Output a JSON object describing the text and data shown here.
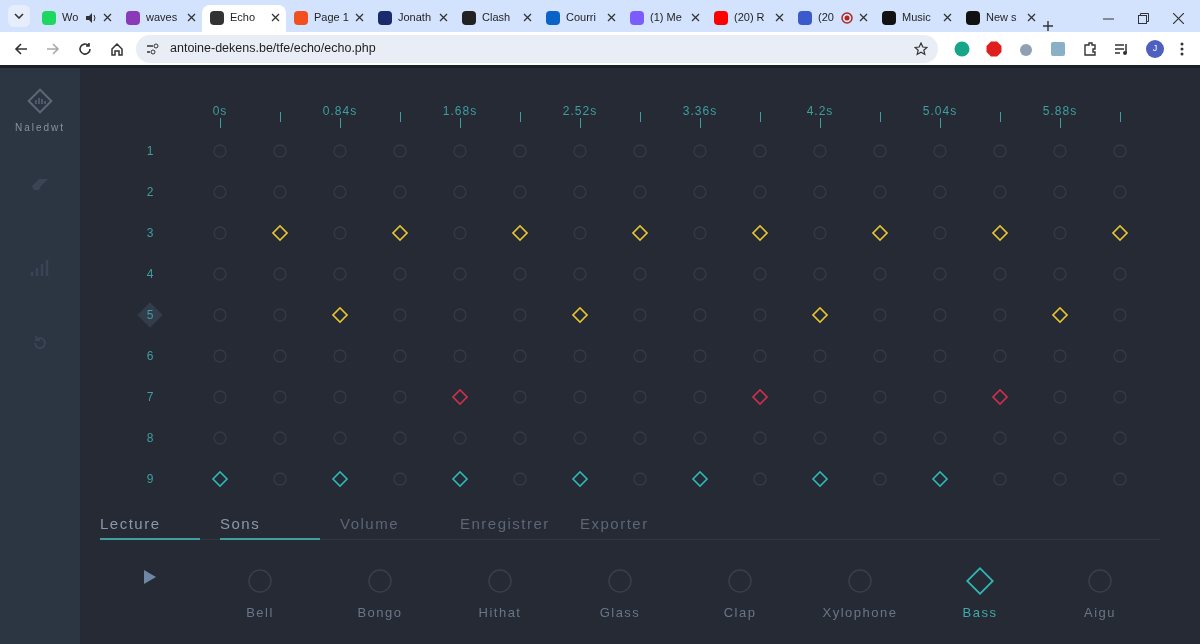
{
  "browser": {
    "tabs": [
      {
        "title": "Wo",
        "color": "#1ed760",
        "audio": true,
        "recording": false,
        "selected": false
      },
      {
        "title": "waves",
        "color": "#8a3ab9",
        "audio": false,
        "recording": false,
        "selected": false
      },
      {
        "title": "Echo",
        "color": "#333333",
        "audio": false,
        "recording": false,
        "selected": true
      },
      {
        "title": "Page 1",
        "color": "#f24e1e",
        "audio": false,
        "recording": false,
        "selected": false
      },
      {
        "title": "Jonath",
        "color": "#1a2a6c",
        "audio": false,
        "recording": false,
        "selected": false
      },
      {
        "title": "Clash",
        "color": "#222222",
        "audio": false,
        "recording": false,
        "selected": false
      },
      {
        "title": "Courri",
        "color": "#0a64c8",
        "audio": false,
        "recording": false,
        "selected": false
      },
      {
        "title": "(1) Me",
        "color": "#7b5cff",
        "audio": false,
        "recording": false,
        "selected": false
      },
      {
        "title": "(20) R",
        "color": "#ff0000",
        "audio": false,
        "recording": false,
        "selected": false
      },
      {
        "title": "(20",
        "color": "#3b5bcc",
        "audio": false,
        "recording": true,
        "selected": false
      },
      {
        "title": "Music",
        "color": "#111111",
        "audio": false,
        "recording": false,
        "selected": false
      },
      {
        "title": "New s",
        "color": "#111111",
        "audio": false,
        "recording": false,
        "selected": false
      }
    ],
    "address": "antoine-dekens.be/tfe/echo/echo.php",
    "profile": "J"
  },
  "sidebar": {
    "brand": "Naledwt"
  },
  "timeline": {
    "labels": [
      "0s",
      "0.84s",
      "1.68s",
      "2.52s",
      "3.36s",
      "4.2s",
      "5.04s",
      "5.88s"
    ]
  },
  "tracks": [
    {
      "label": "1",
      "selected": false,
      "steps": [
        false,
        false,
        false,
        false,
        false,
        false,
        false,
        false,
        false,
        false,
        false,
        false,
        false,
        false,
        false,
        false
      ]
    },
    {
      "label": "2",
      "selected": false,
      "steps": [
        false,
        false,
        false,
        false,
        false,
        false,
        false,
        false,
        false,
        false,
        false,
        false,
        false,
        false,
        false,
        false
      ]
    },
    {
      "label": "3",
      "selected": false,
      "color": "#e8c631",
      "steps": [
        false,
        true,
        false,
        true,
        false,
        true,
        false,
        true,
        false,
        true,
        false,
        true,
        false,
        true,
        false,
        true
      ]
    },
    {
      "label": "4",
      "selected": false,
      "steps": [
        false,
        false,
        false,
        false,
        false,
        false,
        false,
        false,
        false,
        false,
        false,
        false,
        false,
        false,
        false,
        false
      ]
    },
    {
      "label": "5",
      "selected": true,
      "color": "#e8c631",
      "steps": [
        false,
        false,
        true,
        false,
        false,
        false,
        true,
        false,
        false,
        false,
        true,
        false,
        false,
        false,
        true,
        false
      ]
    },
    {
      "label": "6",
      "selected": false,
      "steps": [
        false,
        false,
        false,
        false,
        false,
        false,
        false,
        false,
        false,
        false,
        false,
        false,
        false,
        false,
        false,
        false
      ]
    },
    {
      "label": "7",
      "selected": false,
      "color": "#d0304a",
      "steps": [
        false,
        false,
        false,
        false,
        true,
        false,
        false,
        false,
        false,
        true,
        false,
        false,
        false,
        true,
        false,
        false
      ]
    },
    {
      "label": "8",
      "selected": false,
      "steps": [
        false,
        false,
        false,
        false,
        false,
        false,
        false,
        false,
        false,
        false,
        false,
        false,
        false,
        false,
        false,
        false
      ]
    },
    {
      "label": "9",
      "selected": false,
      "color": "#2fb7b3",
      "steps": [
        true,
        false,
        true,
        false,
        true,
        false,
        true,
        false,
        true,
        false,
        true,
        false,
        true,
        false,
        false,
        false
      ]
    }
  ],
  "panel_tabs": [
    {
      "label": "Lecture",
      "active": true
    },
    {
      "label": "Sons",
      "active": true
    },
    {
      "label": "Volume",
      "active": false
    },
    {
      "label": "Enregistrer",
      "active": false
    },
    {
      "label": "Exporter",
      "active": false
    }
  ],
  "instruments": [
    {
      "name": "Bell",
      "selected": false
    },
    {
      "name": "Bongo",
      "selected": false
    },
    {
      "name": "Hithat",
      "selected": false
    },
    {
      "name": "Glass",
      "selected": false
    },
    {
      "name": "Clap",
      "selected": false
    },
    {
      "name": "Xylophone",
      "selected": false
    },
    {
      "name": "Bass",
      "selected": true
    },
    {
      "name": "Aigu",
      "selected": false
    }
  ]
}
